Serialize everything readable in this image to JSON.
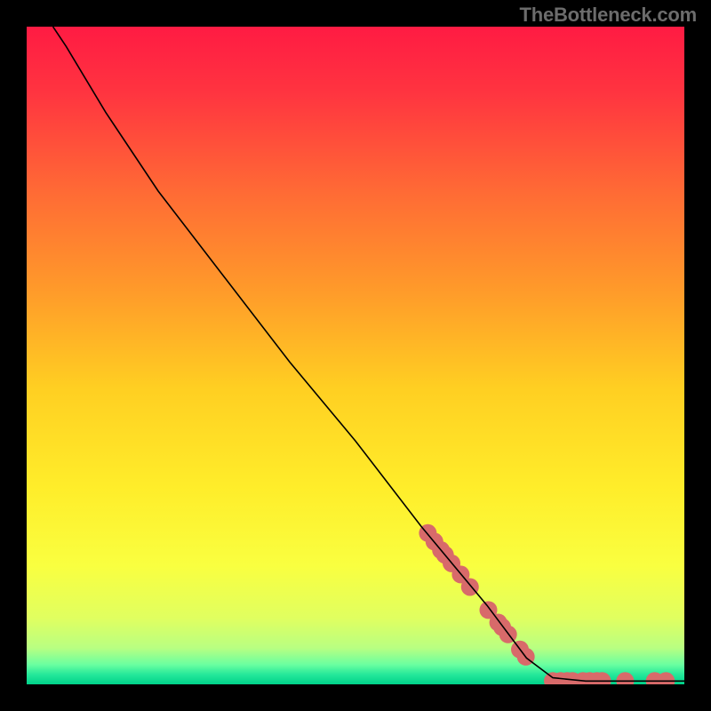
{
  "watermark": "TheBottleneck.com",
  "chart_data": {
    "type": "line",
    "title": "",
    "xlabel": "",
    "ylabel": "",
    "xlim": [
      0,
      100
    ],
    "ylim": [
      0,
      100
    ],
    "grid": false,
    "curve": {
      "name": "bottleneck-curve",
      "color": "#000000",
      "points": [
        {
          "x": 4,
          "y": 100
        },
        {
          "x": 6,
          "y": 97
        },
        {
          "x": 9,
          "y": 92
        },
        {
          "x": 12,
          "y": 87
        },
        {
          "x": 20,
          "y": 75
        },
        {
          "x": 30,
          "y": 62
        },
        {
          "x": 40,
          "y": 49
        },
        {
          "x": 50,
          "y": 37
        },
        {
          "x": 60,
          "y": 24
        },
        {
          "x": 70,
          "y": 12
        },
        {
          "x": 76,
          "y": 4
        },
        {
          "x": 80,
          "y": 1
        },
        {
          "x": 85,
          "y": 0.5
        },
        {
          "x": 90,
          "y": 0.5
        },
        {
          "x": 100,
          "y": 0.5
        }
      ]
    },
    "scatter": {
      "name": "data-points",
      "color": "#d86a6a",
      "radius": 10,
      "points": [
        {
          "x": 61,
          "y": 23.0
        },
        {
          "x": 62,
          "y": 21.7
        },
        {
          "x": 63,
          "y": 20.4
        },
        {
          "x": 63.6,
          "y": 19.7
        },
        {
          "x": 64.6,
          "y": 18.4
        },
        {
          "x": 66.0,
          "y": 16.7
        },
        {
          "x": 67.4,
          "y": 14.8
        },
        {
          "x": 70.2,
          "y": 11.3
        },
        {
          "x": 71.7,
          "y": 9.4
        },
        {
          "x": 72.3,
          "y": 8.7
        },
        {
          "x": 73.2,
          "y": 7.6
        },
        {
          "x": 75.0,
          "y": 5.3
        },
        {
          "x": 75.9,
          "y": 4.2
        },
        {
          "x": 80.0,
          "y": 0.5
        },
        {
          "x": 81.2,
          "y": 0.5
        },
        {
          "x": 82.2,
          "y": 0.5
        },
        {
          "x": 83.0,
          "y": 0.5
        },
        {
          "x": 84.6,
          "y": 0.5
        },
        {
          "x": 85.6,
          "y": 0.5
        },
        {
          "x": 86.7,
          "y": 0.5
        },
        {
          "x": 87.5,
          "y": 0.5
        },
        {
          "x": 91.0,
          "y": 0.5
        },
        {
          "x": 95.5,
          "y": 0.5
        },
        {
          "x": 97.2,
          "y": 0.5
        }
      ]
    },
    "gradient_stops": [
      {
        "offset": 0.0,
        "color": "#ff1b43"
      },
      {
        "offset": 0.1,
        "color": "#ff3440"
      },
      {
        "offset": 0.25,
        "color": "#ff6a35"
      },
      {
        "offset": 0.4,
        "color": "#ff9a2a"
      },
      {
        "offset": 0.55,
        "color": "#ffcf22"
      },
      {
        "offset": 0.7,
        "color": "#ffed2a"
      },
      {
        "offset": 0.82,
        "color": "#f9ff40"
      },
      {
        "offset": 0.9,
        "color": "#e0ff60"
      },
      {
        "offset": 0.945,
        "color": "#b8ff82"
      },
      {
        "offset": 0.97,
        "color": "#6affa0"
      },
      {
        "offset": 0.985,
        "color": "#25e89a"
      },
      {
        "offset": 1.0,
        "color": "#00d28a"
      }
    ]
  }
}
